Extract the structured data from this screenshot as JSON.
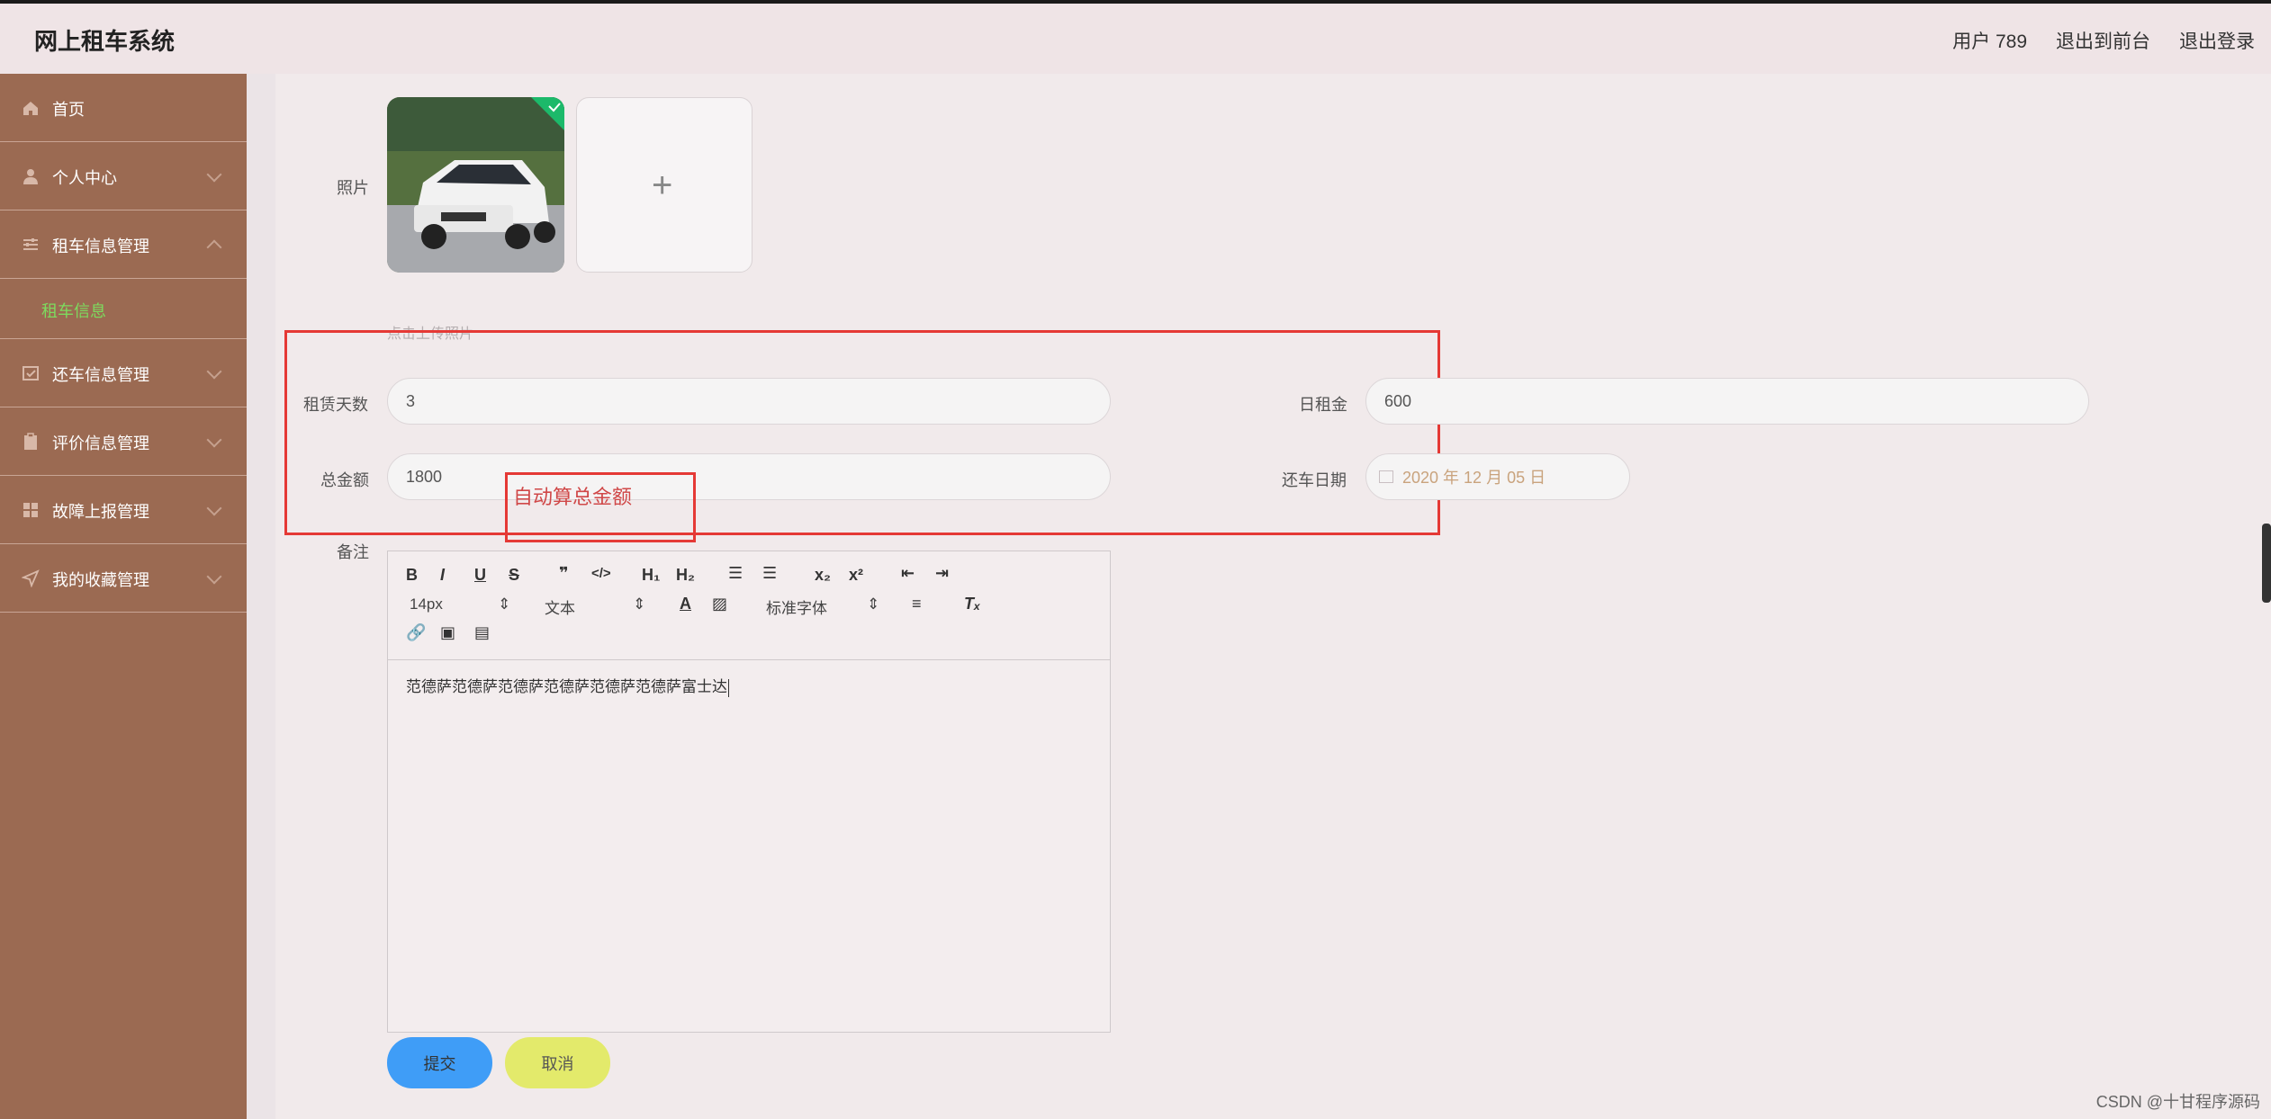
{
  "header": {
    "app_title": "网上租车系统",
    "user": "用户 789",
    "exit_front": "退出到前台",
    "logout": "退出登录"
  },
  "sidebar": {
    "items": [
      {
        "label": "首页",
        "icon": "home-icon"
      },
      {
        "label": "个人中心",
        "icon": "user-icon"
      },
      {
        "label": "租车信息管理",
        "icon": "sliders-icon",
        "expanded": true
      },
      {
        "label": "租车信息",
        "sub": true,
        "active": true
      },
      {
        "label": "还车信息管理",
        "icon": "checkbox-icon"
      },
      {
        "label": "评价信息管理",
        "icon": "clipboard-icon"
      },
      {
        "label": "故障上报管理",
        "icon": "grid-icon"
      },
      {
        "label": "我的收藏管理",
        "icon": "send-icon"
      }
    ]
  },
  "form": {
    "photo_label": "照片",
    "upload_hint": "点击上传照片",
    "days_label": "租赁天数",
    "days_value": "3",
    "daily_label": "日租金",
    "daily_value": "600",
    "total_label": "总金额",
    "total_value": "1800",
    "return_label": "还车日期",
    "return_value": "2020 年 12 月 05 日",
    "remark_label": "备注",
    "annotation": "自动算总金额"
  },
  "editor": {
    "font_size": "14px",
    "paragraph": "文本",
    "font_family": "标准字体",
    "content": "范德萨范德萨范德萨范德萨范德萨范德萨富士达"
  },
  "buttons": {
    "submit": "提交",
    "cancel": "取消"
  },
  "watermark": "CSDN @十甘程序源码",
  "colors": {
    "sidebar_bg": "#9b6a52",
    "active_sub": "#7ddb5e",
    "submit_bg": "#3f9df7",
    "cancel_bg": "#e3ea6b",
    "highlight": "#e53935"
  }
}
